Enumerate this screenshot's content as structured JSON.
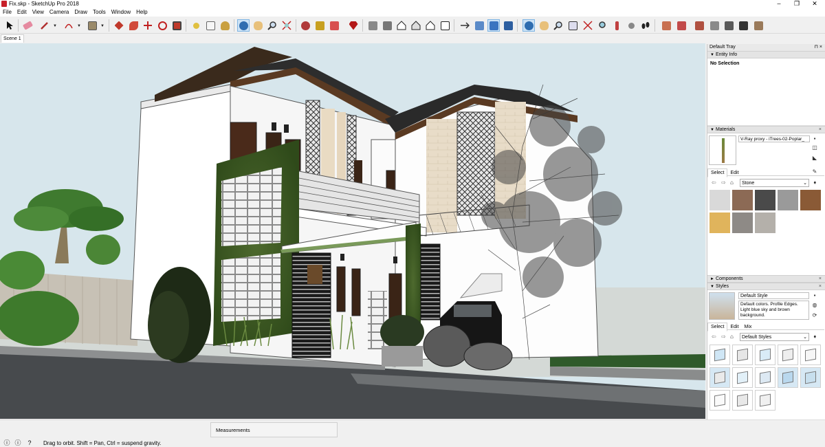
{
  "window": {
    "title": "Fix.skp - SketchUp Pro 2018",
    "controls": [
      "–",
      "❐",
      "✕"
    ]
  },
  "menu": [
    "File",
    "Edit",
    "View",
    "Camera",
    "Draw",
    "Tools",
    "Window",
    "Help"
  ],
  "scenes": {
    "active": "Scene 1"
  },
  "tray": {
    "title": "Default Tray",
    "pin": "⊓ ×",
    "entity_info": {
      "header": "Entity Info",
      "selection": "No Selection"
    },
    "materials": {
      "header": "Materials",
      "name": "V-Ray proxy - iTrees-02-Poplar_",
      "tabs": [
        "Select",
        "Edit"
      ],
      "collection": "Stone",
      "swatches": [
        "#d9d9d9",
        "#8c6a55",
        "#4a4a4a",
        "#9a9a9a",
        "#8a5a36",
        "#e0b45c",
        "#8e8a86",
        "#b4b0aa"
      ]
    },
    "components": {
      "header": "Components"
    },
    "styles": {
      "header": "Styles",
      "name": "Default Style",
      "description": "Default colors. Profile Edges. Light blue sky and brown background.",
      "tabs": [
        "Select",
        "Edit",
        "Mix"
      ],
      "collection": "Default Styles"
    }
  },
  "status": {
    "hint": "Drag to orbit. Shift = Pan, Ctrl = suspend gravity.",
    "measurements_label": "Measurements"
  },
  "colors": {
    "accent": "#cde3f6",
    "sky": "#d7e6ec",
    "asphalt": "#474a4d"
  }
}
